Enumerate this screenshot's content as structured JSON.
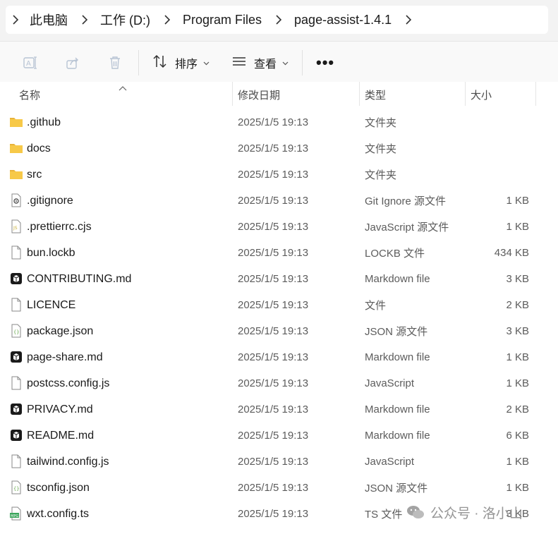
{
  "breadcrumb": {
    "items": [
      {
        "label": "此电脑"
      },
      {
        "label": "工作 (D:)"
      },
      {
        "label": "Program Files"
      },
      {
        "label": "page-assist-1.4.1"
      }
    ]
  },
  "toolbar": {
    "sort_label": "排序",
    "view_label": "查看",
    "more_label": "•••"
  },
  "columns": {
    "name": "名称",
    "modified": "修改日期",
    "type": "类型",
    "size": "大小"
  },
  "files": [
    {
      "name": ".github",
      "date": "2025/1/5 19:13",
      "type": "文件夹",
      "size": "",
      "icon": "folder-icon"
    },
    {
      "name": "docs",
      "date": "2025/1/5 19:13",
      "type": "文件夹",
      "size": "",
      "icon": "folder-icon"
    },
    {
      "name": "src",
      "date": "2025/1/5 19:13",
      "type": "文件夹",
      "size": "",
      "icon": "folder-icon"
    },
    {
      "name": ".gitignore",
      "date": "2025/1/5 19:13",
      "type": "Git Ignore 源文件",
      "size": "1 KB",
      "icon": "gitignore-file-icon"
    },
    {
      "name": ".prettierrc.cjs",
      "date": "2025/1/5 19:13",
      "type": "JavaScript 源文件",
      "size": "1 KB",
      "icon": "js-file-icon"
    },
    {
      "name": "bun.lockb",
      "date": "2025/1/5 19:13",
      "type": "LOCKB 文件",
      "size": "434 KB",
      "icon": "blank-file-icon"
    },
    {
      "name": "CONTRIBUTING.md",
      "date": "2025/1/5 19:13",
      "type": "Markdown file",
      "size": "3 KB",
      "icon": "markdown-file-icon"
    },
    {
      "name": "LICENCE",
      "date": "2025/1/5 19:13",
      "type": "文件",
      "size": "2 KB",
      "icon": "blank-file-icon"
    },
    {
      "name": "package.json",
      "date": "2025/1/5 19:13",
      "type": "JSON 源文件",
      "size": "3 KB",
      "icon": "json-file-icon"
    },
    {
      "name": "page-share.md",
      "date": "2025/1/5 19:13",
      "type": "Markdown file",
      "size": "1 KB",
      "icon": "markdown-file-icon"
    },
    {
      "name": "postcss.config.js",
      "date": "2025/1/5 19:13",
      "type": "JavaScript",
      "size": "1 KB",
      "icon": "blank-file-icon"
    },
    {
      "name": "PRIVACY.md",
      "date": "2025/1/5 19:13",
      "type": "Markdown file",
      "size": "2 KB",
      "icon": "markdown-file-icon"
    },
    {
      "name": "README.md",
      "date": "2025/1/5 19:13",
      "type": "Markdown file",
      "size": "6 KB",
      "icon": "markdown-file-icon"
    },
    {
      "name": "tailwind.config.js",
      "date": "2025/1/5 19:13",
      "type": "JavaScript",
      "size": "1 KB",
      "icon": "blank-file-icon"
    },
    {
      "name": "tsconfig.json",
      "date": "2025/1/5 19:13",
      "type": "JSON 源文件",
      "size": "1 KB",
      "icon": "json-file-icon"
    },
    {
      "name": "wxt.config.ts",
      "date": "2025/1/5 19:13",
      "type": "TS 文件",
      "size": "3 KB",
      "icon": "ts-file-icon"
    }
  ],
  "watermark": {
    "text": "公众号 · 洛小山"
  },
  "colors": {
    "folder": "#f7c948",
    "folder_dark": "#e8b23a",
    "markdown_bg": "#1a1a1a",
    "json_green": "#6aa84f",
    "ts_green": "#3aa55b",
    "js_yellow": "#c9b03a"
  }
}
